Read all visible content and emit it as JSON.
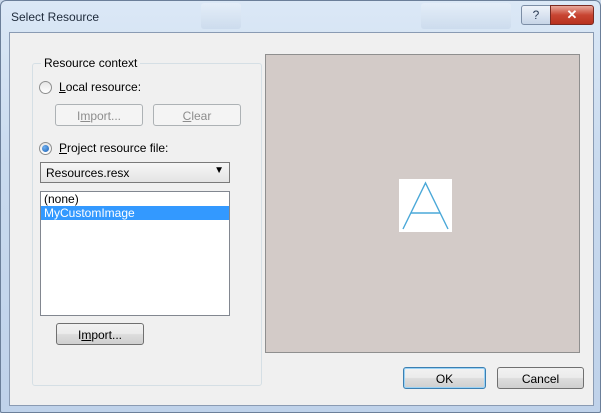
{
  "window": {
    "title": "Select Resource",
    "help_glyph": "?",
    "close_glyph": "✕"
  },
  "resource_context": {
    "caption": "Resource context",
    "local": {
      "label_accel": "L",
      "label_rest": "ocal resource:",
      "checked": false,
      "import_accel": "m",
      "import_pre": "I",
      "import_rest": "port...",
      "clear_accel": "C",
      "clear_rest": "lear"
    },
    "project": {
      "label_accel": "P",
      "label_rest": "roject resource file:",
      "checked": true,
      "selected_file": "Resources.resx",
      "list_items": [
        {
          "label": "(none)",
          "selected": false
        },
        {
          "label": "MyCustomImage",
          "selected": true
        }
      ],
      "import_pre": "I",
      "import_accel": "m",
      "import_rest": "port..."
    }
  },
  "preview": {
    "image_glyph": "A"
  },
  "footer": {
    "ok_label": "OK",
    "cancel_label": "Cancel"
  },
  "colors": {
    "selection": "#3399ff",
    "preview_bg": "#d3cbc8",
    "close_red": "#c84532"
  }
}
